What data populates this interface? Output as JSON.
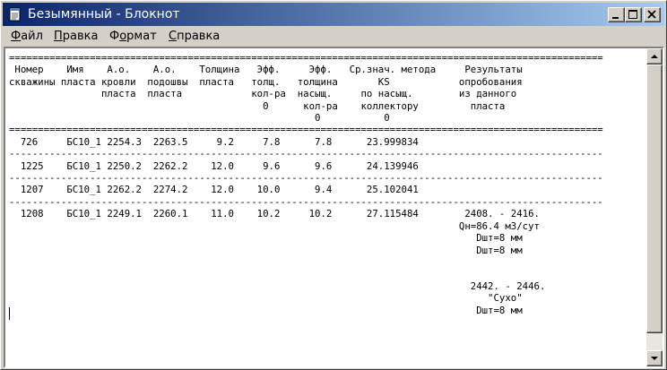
{
  "window": {
    "title": "Безымянный - Блокнот",
    "icon": "notepad-icon",
    "title_gradient": [
      "#0a246a",
      "#a6caf0"
    ]
  },
  "caption_buttons": [
    {
      "name": "minimize-button",
      "icon": "minimize-icon"
    },
    {
      "name": "maximize-button",
      "icon": "maximize-icon"
    },
    {
      "name": "close-button",
      "icon": "close-icon"
    }
  ],
  "menu": [
    {
      "label": "Файл",
      "underline": "Ф"
    },
    {
      "label": "Правка",
      "underline": "П"
    },
    {
      "label": "Формат",
      "underline": "о"
    },
    {
      "label": "Справка",
      "underline": "С"
    }
  ],
  "editor": {
    "text_lines": [
      "=======================================================================================================",
      " Номер    Имя    А.о.    А.о.    Толщина   Эфф.     Эфф.   Ср.знач. метода     Результаты",
      "скважины пласта кровли  подошвы  пласта   толщ.   толщина       KS            опробования",
      "                пласта  пласта            кол-ра  насыщ.     по насыщ.        из данного",
      "                                            0      кол-ра    коллектору         пласта",
      "                                                     0           0",
      "=======================================================================================================",
      "  726     БС10_1 2254.3  2263.5     9.2     7.8      7.8      23.999834",
      "-------------------------------------------------------------------------------------------------------",
      "  1225    БС10_1 2250.2  2262.2    12.0     9.6      9.6      24.139946",
      "-------------------------------------------------------------------------------------------------------",
      "  1207    БС10_1 2262.2  2274.2    12.0    10.0      9.4      25.102041",
      "-------------------------------------------------------------------------------------------------------",
      "  1208    БС10_1 2249.1  2260.1    11.0    10.2     10.2      27.115484        2408. - 2416.",
      "                                                                              Qн=86.4 м3/сут",
      "                                                                                 Dшт=8 мм",
      "                                                                                 Dшт=8 мм",
      "",
      "",
      "                                                                                2442. - 2446.",
      "                                                                                   \"Сухо\"",
      "                                                                                 Dшт=8 мм"
    ]
  },
  "scrollbar": {
    "up_icon": "arrow-up-icon",
    "down_icon": "arrow-down-icon"
  }
}
